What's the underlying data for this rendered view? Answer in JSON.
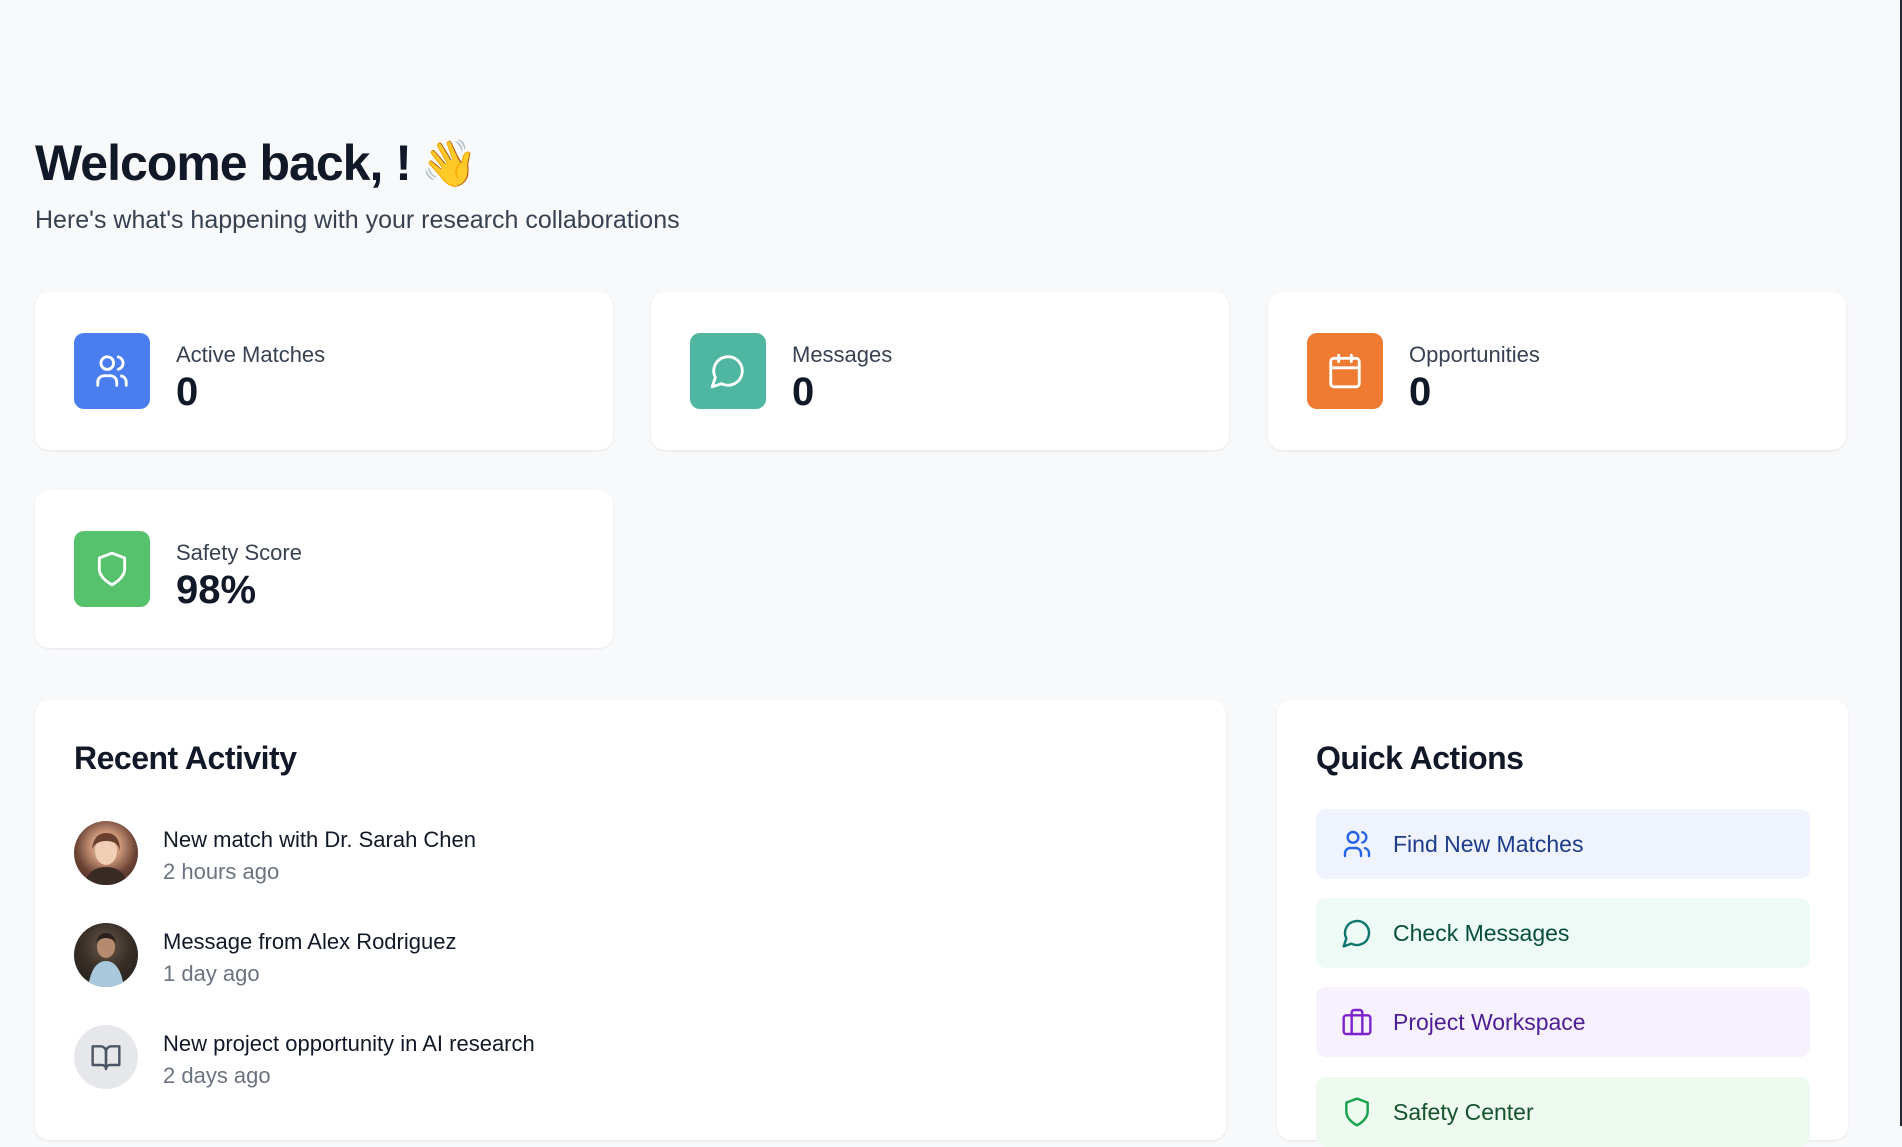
{
  "header": {
    "title": "Welcome back, !",
    "wave_emoji": "👋",
    "subtitle": "Here's what's happening with your research collaborations"
  },
  "stats": [
    {
      "label": "Active Matches",
      "value": "0",
      "icon": "users-icon",
      "color": "#4a7ef0"
    },
    {
      "label": "Messages",
      "value": "0",
      "icon": "message-icon",
      "color": "#4fb6a2"
    },
    {
      "label": "Opportunities",
      "value": "0",
      "icon": "calendar-icon",
      "color": "#ef7a32"
    },
    {
      "label": "Safety Score",
      "value": "98%",
      "icon": "shield-icon",
      "color": "#56c26c"
    }
  ],
  "recent_activity": {
    "title": "Recent Activity",
    "items": [
      {
        "text": "New match with Dr. Sarah Chen",
        "time": "2 hours ago",
        "avatar": "photo"
      },
      {
        "text": "Message from Alex Rodriguez",
        "time": "1 day ago",
        "avatar": "photo"
      },
      {
        "text": "New project opportunity in AI research",
        "time": "2 days ago",
        "avatar": "book-icon"
      }
    ]
  },
  "quick_actions": {
    "title": "Quick Actions",
    "items": [
      {
        "label": "Find New Matches",
        "icon": "users-icon",
        "bg": "#eef3fd",
        "color": "#1e3a8a"
      },
      {
        "label": "Check Messages",
        "icon": "message-icon",
        "bg": "#eefaf5",
        "color": "#064e3b"
      },
      {
        "label": "Project Workspace",
        "icon": "briefcase-icon",
        "bg": "#f6f1fd",
        "color": "#4c1d95"
      },
      {
        "label": "Safety Center",
        "icon": "shield-icon",
        "bg": "#eef9f0",
        "color": "#14532d"
      }
    ]
  }
}
